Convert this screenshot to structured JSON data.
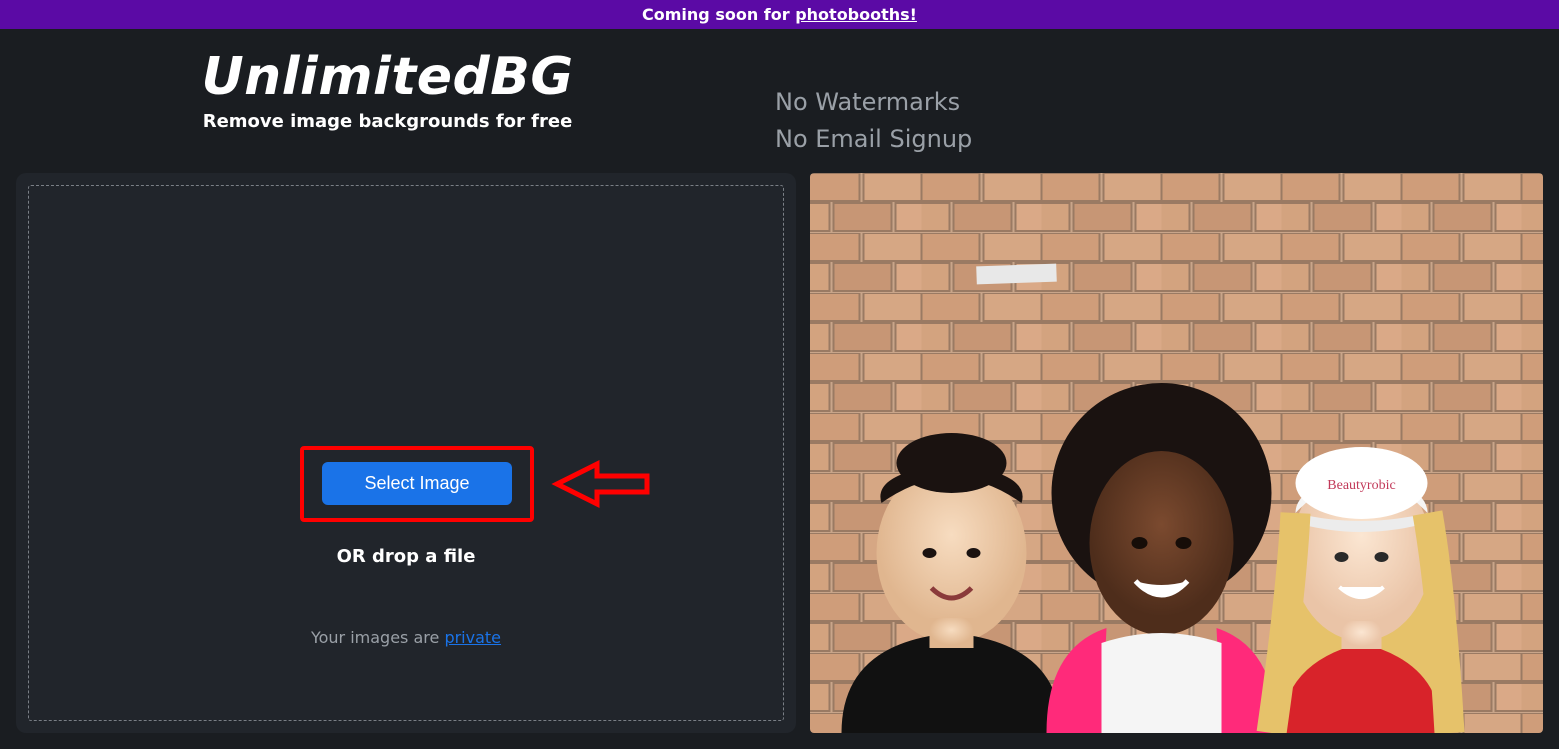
{
  "banner": {
    "prefix": "Coming soon for ",
    "link": "photobooths!"
  },
  "brand": {
    "logo": "UnlimitedBG",
    "tagline": "Remove image backgrounds for free"
  },
  "features": [
    "No Watermarks",
    "No Email Signup"
  ],
  "upload": {
    "button": "Select Image",
    "or_text": "OR drop a file",
    "privacy_prefix": "Your images are ",
    "privacy_link": "private"
  },
  "sample": {
    "cap_text": "Beautyrobic"
  },
  "colors": {
    "banner_bg": "#5b0aa5",
    "page_bg": "#1a1d21",
    "panel_bg": "#21252b",
    "button_bg": "#1a73e8",
    "highlight_red": "#ff0000",
    "muted": "#9aa0a7"
  }
}
